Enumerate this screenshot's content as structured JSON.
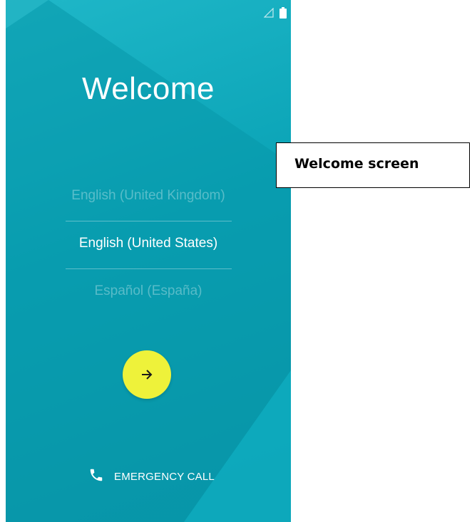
{
  "screen": {
    "title": "Welcome",
    "languages": [
      {
        "label": "English (United Kingdom)",
        "selected": false
      },
      {
        "label": "English (United States)",
        "selected": true
      },
      {
        "label": "Español (España)",
        "selected": false
      }
    ],
    "next_icon": "arrow-right-icon",
    "emergency_label": "EMERGENCY CALL",
    "emergency_icon": "phone-icon"
  },
  "status_bar": {
    "icons": [
      "signal-icon",
      "battery-icon"
    ]
  },
  "callout": {
    "text": "Welcome screen"
  },
  "colors": {
    "background": "#0aa3b6",
    "accent_button": "#eef23a",
    "text": "#ffffff"
  }
}
